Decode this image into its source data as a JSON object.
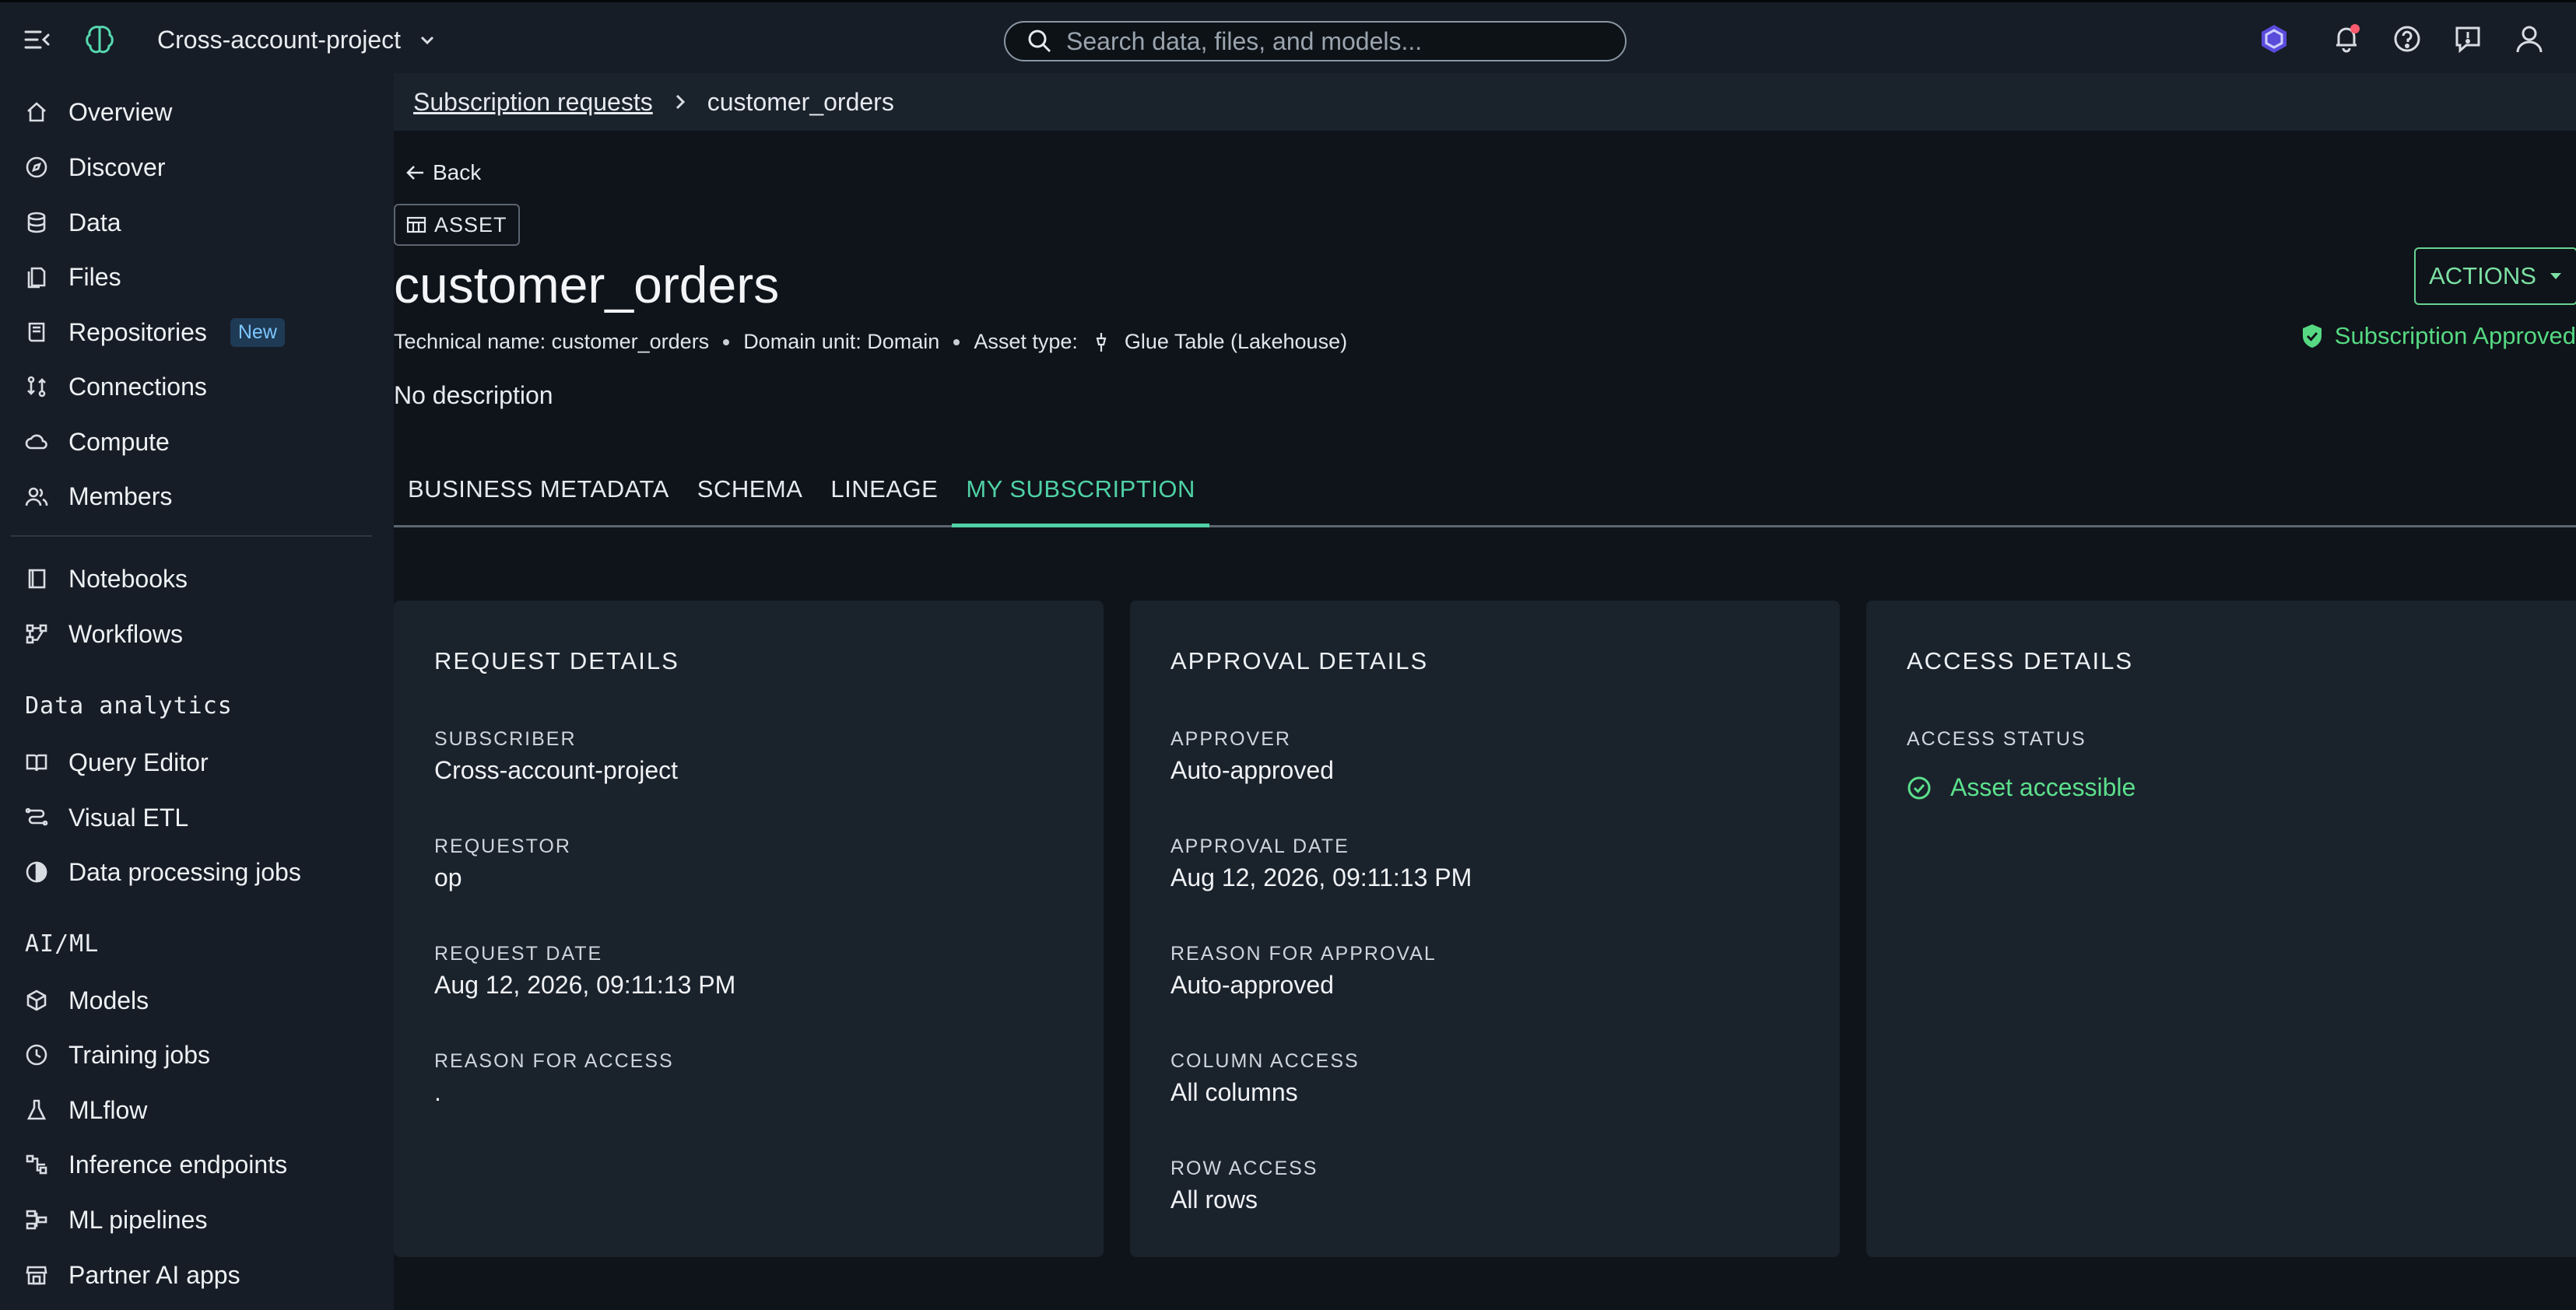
{
  "app": {
    "project_name": "Cross-account-project",
    "search_placeholder": "Search data, files, and models..."
  },
  "colors": {
    "accent": "#4fd1a5",
    "success": "#56d982",
    "notification_dot": "#ff5b6e",
    "badge_text": "#7cc6ff"
  },
  "sidebar": {
    "items": [
      {
        "label": "Overview",
        "icon": "home-icon"
      },
      {
        "label": "Discover",
        "icon": "compass-icon"
      },
      {
        "label": "Data",
        "icon": "database-icon"
      },
      {
        "label": "Files",
        "icon": "file-icon"
      },
      {
        "label": "Repositories",
        "icon": "repository-icon",
        "badge": "New"
      },
      {
        "label": "Connections",
        "icon": "connections-icon"
      },
      {
        "label": "Compute",
        "icon": "cloud-icon"
      },
      {
        "label": "Members",
        "icon": "members-icon"
      }
    ],
    "tools": [
      {
        "label": "Notebooks",
        "icon": "notebook-icon"
      },
      {
        "label": "Workflows",
        "icon": "workflow-icon"
      }
    ],
    "data_analytics": {
      "title": "Data analytics",
      "items": [
        {
          "label": "Query Editor",
          "icon": "book-icon"
        },
        {
          "label": "Visual ETL",
          "icon": "etl-icon"
        },
        {
          "label": "Data processing jobs",
          "icon": "job-icon"
        }
      ]
    },
    "aiml": {
      "title": "AI/ML",
      "items": [
        {
          "label": "Models",
          "icon": "cube-icon"
        },
        {
          "label": "Training jobs",
          "icon": "training-icon"
        },
        {
          "label": "MLflow",
          "icon": "flask-icon"
        },
        {
          "label": "Inference endpoints",
          "icon": "endpoint-icon"
        },
        {
          "label": "ML pipelines",
          "icon": "pipeline-icon"
        },
        {
          "label": "Partner AI apps",
          "icon": "store-icon"
        }
      ]
    }
  },
  "breadcrumb": {
    "parent": "Subscription requests",
    "current": "customer_orders"
  },
  "page": {
    "back_label": "Back",
    "asset_chip": "ASSET",
    "title": "customer_orders",
    "technical_name": "Technical name: customer_orders",
    "domain_unit": "Domain unit: Domain",
    "asset_type_label": "Asset type:",
    "asset_type": "Glue Table (Lakehouse)",
    "description": "No description",
    "actions_label": "ACTIONS",
    "status": "Subscription Approved"
  },
  "tabs": [
    {
      "label": "BUSINESS METADATA",
      "active": false
    },
    {
      "label": "SCHEMA",
      "active": false
    },
    {
      "label": "LINEAGE",
      "active": false
    },
    {
      "label": "MY SUBSCRIPTION",
      "active": true
    }
  ],
  "request_details": {
    "title": "REQUEST DETAILS",
    "subscriber_label": "SUBSCRIBER",
    "subscriber": "Cross-account-project",
    "requestor_label": "REQUESTOR",
    "requestor": "op",
    "request_date_label": "REQUEST DATE",
    "request_date": "Aug 12, 2026, 09:11:13 PM",
    "reason_label": "REASON FOR ACCESS",
    "reason": "."
  },
  "approval_details": {
    "title": "APPROVAL DETAILS",
    "approver_label": "APPROVER",
    "approver": "Auto-approved",
    "approval_date_label": "APPROVAL DATE",
    "approval_date": "Aug 12, 2026, 09:11:13 PM",
    "reason_label": "REASON FOR APPROVAL",
    "reason": "Auto-approved",
    "column_access_label": "COLUMN ACCESS",
    "column_access": "All columns",
    "row_access_label": "ROW ACCESS",
    "row_access": "All rows"
  },
  "access_details": {
    "title": "ACCESS DETAILS",
    "status_label": "ACCESS STATUS",
    "status": "Asset accessible"
  }
}
